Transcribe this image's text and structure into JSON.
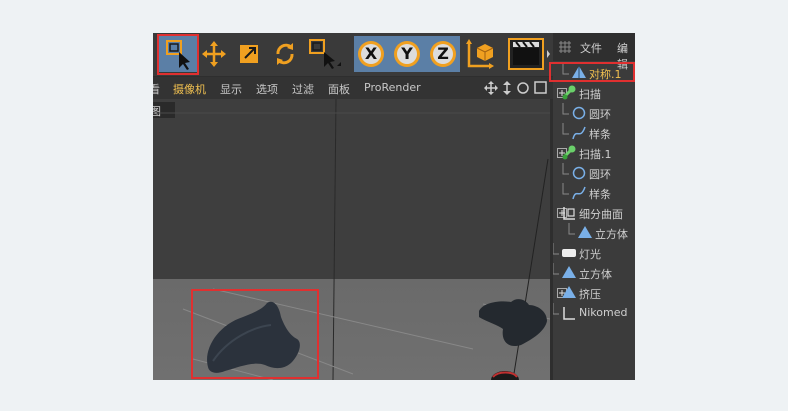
{
  "toolbar": {
    "buttons": [
      {
        "name": "select-tool-button",
        "icon": "select-cursor-icon"
      },
      {
        "name": "move-tool-button",
        "icon": "move-arrows-icon"
      },
      {
        "name": "scale-tool-button",
        "icon": "scale-box-icon"
      },
      {
        "name": "rotate-tool-button",
        "icon": "rotate-arrows-icon"
      },
      {
        "name": "live-select-button",
        "icon": "live-select-icon"
      },
      {
        "name": "x-axis-button",
        "label": "X"
      },
      {
        "name": "y-axis-button",
        "label": "Y"
      },
      {
        "name": "z-axis-button",
        "label": "Z"
      },
      {
        "name": "coordinate-system-button",
        "icon": "world-axis-icon"
      },
      {
        "name": "render-view-button",
        "icon": "clapboard-icon"
      }
    ],
    "accent": "#f0a020",
    "selected_color": "#5b7fa6"
  },
  "menu": {
    "items": [
      "看",
      "摄像机",
      "显示",
      "选项",
      "过滤",
      "面板",
      "ProRender"
    ],
    "active_index": 1
  },
  "viewport": {
    "view_label": "图"
  },
  "object_manager": {
    "header": {
      "file_label": "文件",
      "edit_label": "编辑"
    },
    "items": [
      {
        "label": "对称.1",
        "icon": "symmetry-icon",
        "selected": true
      },
      {
        "label": "扫描",
        "icon": "sweep-icon"
      },
      {
        "label": "圆环",
        "icon": "circle-spline-icon"
      },
      {
        "label": "样条",
        "icon": "spline-icon"
      },
      {
        "label": "扫描.1",
        "icon": "sweep-icon"
      },
      {
        "label": "圆环",
        "icon": "circle-spline-icon"
      },
      {
        "label": "样条",
        "icon": "spline-icon"
      },
      {
        "label": "细分曲面",
        "icon": "subdivision-surface-icon"
      },
      {
        "label": "立方体",
        "icon": "cube-icon"
      },
      {
        "label": "灯光",
        "icon": "light-icon"
      },
      {
        "label": "立方体",
        "icon": "cube-icon"
      },
      {
        "label": "挤压",
        "icon": "extrude-icon"
      },
      {
        "label": "Nikomed",
        "icon": "null-icon"
      }
    ]
  },
  "highlight_color": "#e03030"
}
